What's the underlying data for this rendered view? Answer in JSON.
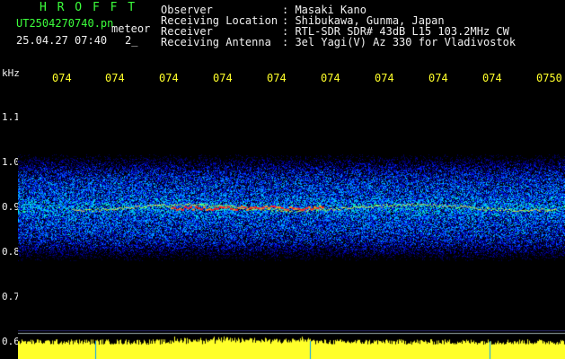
{
  "header": {
    "title": "H R O F F T",
    "filename": "UT2504270740.pn",
    "meteor_label": "meteor",
    "datetime": "25.04.27 07:40",
    "count": "2_",
    "fields": [
      {
        "label": "Observer",
        "value": ": Masaki Kano"
      },
      {
        "label": "Receiving Location",
        "value": ": Shibukawa, Gunma, Japan"
      },
      {
        "label": "Receiver",
        "value": ": RTL-SDR SDR# 43dB L15 103.2MHz CW"
      },
      {
        "label": "Receiving Antenna",
        "value": ": 3el Yagi(V) Az 330 for Vladivostok"
      }
    ]
  },
  "chart_data": {
    "type": "heatmap",
    "ylabel": "kHz",
    "ylim": [
      0.6,
      1.15
    ],
    "y_ticks": [
      "1.1",
      "1.0",
      "0.9",
      "0.8",
      "0.7",
      "0.6"
    ],
    "y_tick_values": [
      1.1,
      1.0,
      0.9,
      0.8,
      0.7,
      0.6
    ],
    "x_ticks": [
      "074",
      "074",
      "074",
      "074",
      "074",
      "074",
      "074",
      "074",
      "074",
      "0750"
    ],
    "noise_band_khz": [
      0.78,
      1.02
    ],
    "signal_center_khz": 0.9,
    "colors": {
      "low": "#0000a0",
      "mid": "#00c8ff",
      "high": "#ff2020",
      "bar": "#ffff2a"
    }
  }
}
